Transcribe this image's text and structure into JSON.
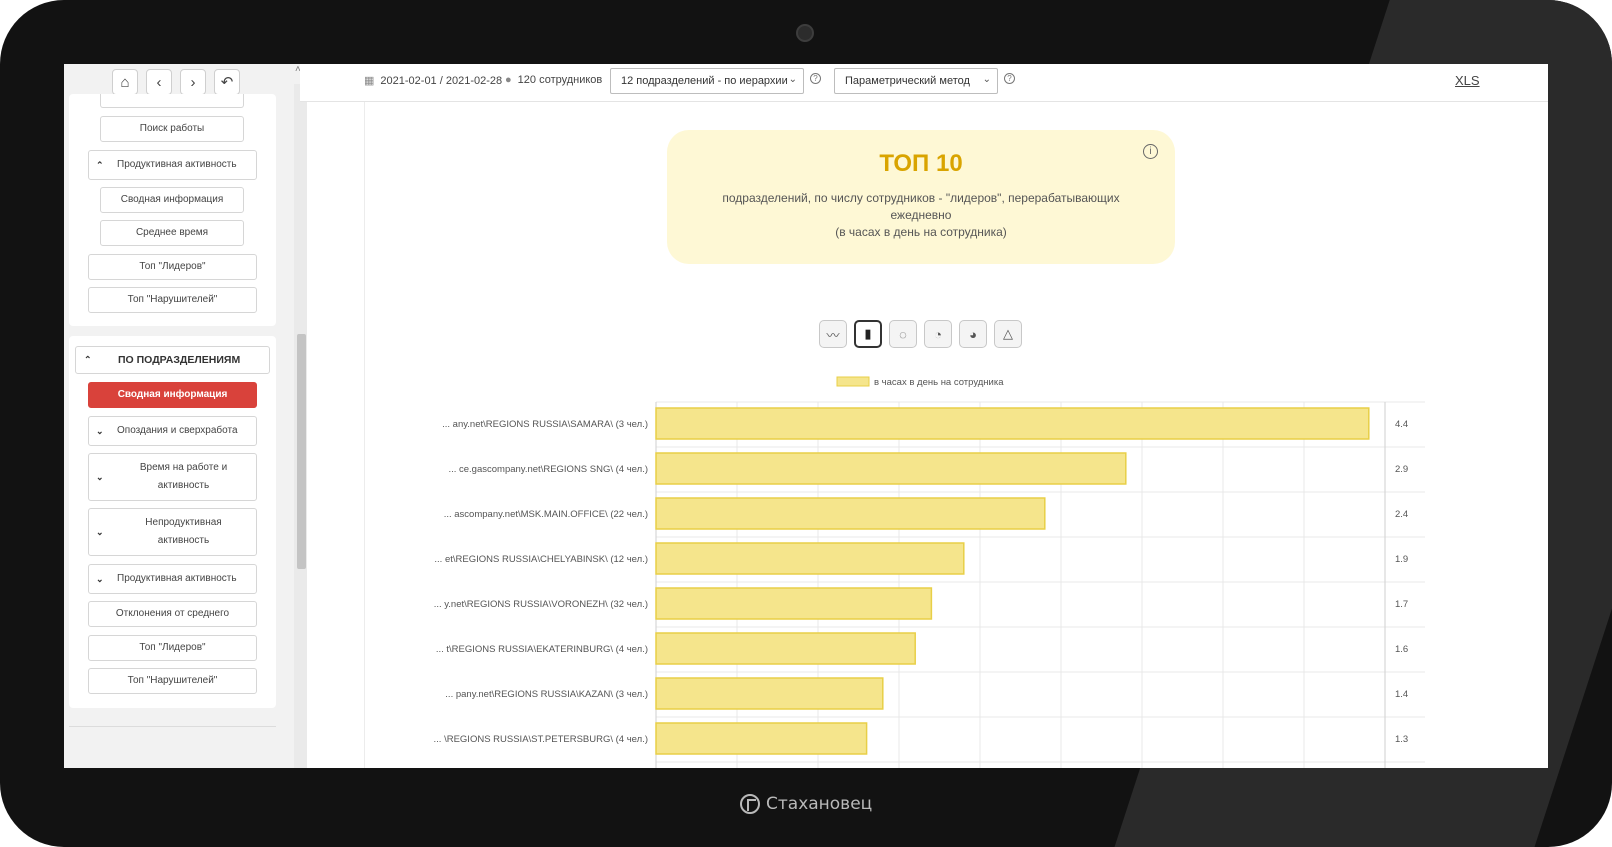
{
  "brand": {
    "name": "Стахановец"
  },
  "sidebar": {
    "top_items": [
      {
        "label": "Поиск работы"
      }
    ],
    "group1": {
      "header": "Продуктивная активность",
      "items": [
        {
          "label": "Сводная информация"
        },
        {
          "label": "Среднее время"
        }
      ]
    },
    "group1_tail": [
      {
        "label": "Топ \"Лидеров\""
      },
      {
        "label": "Топ \"Нарушителей\""
      }
    ],
    "section2": {
      "header": "ПО ПОДРАЗДЕЛЕНИЯМ",
      "items": [
        {
          "label": "Сводная информация",
          "active": true
        },
        {
          "label": "Опоздания и сверхработа",
          "chevron": true
        },
        {
          "label": "Время на работе и активность",
          "chevron": true
        },
        {
          "label": "Непродуктивная активность",
          "chevron": true
        },
        {
          "label": "Продуктивная активность",
          "chevron": true
        },
        {
          "label": "Отклонения от среднего"
        },
        {
          "label": "Топ \"Лидеров\""
        },
        {
          "label": "Топ \"Нарушителей\""
        }
      ]
    }
  },
  "topbar": {
    "date_range": "2021-02-01 / 2021-02-28",
    "employees": "120 сотрудников",
    "department_select": "12 подразделений - по иерархии",
    "method_select": "Параметрический метод",
    "xls": "XLS"
  },
  "title_card": {
    "title": "ТОП 10",
    "subtitle_line1": "подразделений, по числу сотрудников - \"лидеров\", перерабатывающих ежедневно",
    "subtitle_line2": "(в часах в день на сотрудника)"
  },
  "chart_type_buttons": [
    "line-chart-icon",
    "bar-chart-icon",
    "doughnut-chart-icon",
    "pie-chart-icon",
    "polar-area-chart-icon",
    "radar-chart-icon"
  ],
  "chart_data": {
    "type": "bar",
    "orientation": "horizontal",
    "legend": "в часах в день на сотрудника",
    "legend_position": "top",
    "categories": [
      "... any.net\\REGIONS RUSSIA\\SAMARA\\ (3 чел.)",
      "... ce.gascompany.net\\REGIONS SNG\\ (4 чел.)",
      "... ascompany.net\\MSK.MAIN.OFFICE\\ (22 чел.)",
      "... et\\REGIONS RUSSIA\\CHELYABINSK\\ (12 чел.)",
      "... y.net\\REGIONS RUSSIA\\VORONEZH\\ (32 чел.)",
      "... t\\REGIONS RUSSIA\\EKATERINBURG\\ (4 чел.)",
      "... pany.net\\REGIONS RUSSIA\\KAZAN\\ (3 чел.)",
      "... \\REGIONS RUSSIA\\ST.PETERSBURG\\ (4 чел.)"
    ],
    "values": [
      4.4,
      2.9,
      2.4,
      1.9,
      1.7,
      1.6,
      1.4,
      1.3
    ],
    "value_labels": [
      "4.4",
      "2.9",
      "2.4",
      "1.9",
      "1.7",
      "1.6",
      "1.4",
      "1.3"
    ],
    "xlim": [
      0,
      4.5
    ],
    "grid": true,
    "bar_color": "#f5e58c",
    "bar_border": "#e8cf47"
  }
}
